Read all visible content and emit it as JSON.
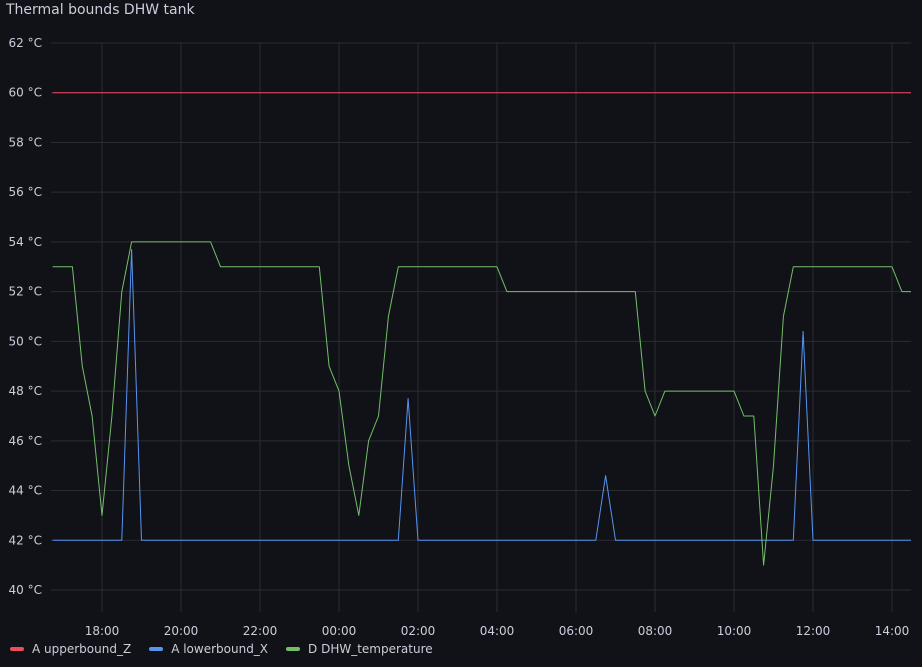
{
  "panel": {
    "title": "Thermal bounds DHW tank"
  },
  "chart_data": {
    "type": "line",
    "title": "Thermal bounds DHW tank",
    "y_unit": "°C",
    "ylim": [
      40,
      62
    ],
    "y_ticks": [
      "62 °C",
      "60 °C",
      "58 °C",
      "56 °C",
      "54 °C",
      "52 °C",
      "50 °C",
      "48 °C",
      "46 °C",
      "44 °C",
      "42 °C",
      "40 °C"
    ],
    "x_ticks": [
      "18:00",
      "20:00",
      "22:00",
      "00:00",
      "02:00",
      "04:00",
      "06:00",
      "08:00",
      "10:00",
      "12:00",
      "14:00"
    ],
    "grid": true,
    "legend_position": "bottom-left",
    "series": [
      {
        "name": "A upperbound_Z",
        "color": "#f2495c",
        "points": [
          [
            "16:45",
            60
          ],
          [
            "14:30",
            60
          ]
        ]
      },
      {
        "name": "A lowerbound_X",
        "color": "#5794f2",
        "points": [
          [
            "16:45",
            42
          ],
          [
            "18:30",
            42
          ],
          [
            "18:45",
            53.7
          ],
          [
            "19:00",
            42
          ],
          [
            "01:30",
            42
          ],
          [
            "01:45",
            47.7
          ],
          [
            "02:00",
            42
          ],
          [
            "06:30",
            42
          ],
          [
            "06:45",
            44.6
          ],
          [
            "07:00",
            42
          ],
          [
            "11:30",
            42
          ],
          [
            "11:45",
            50.4
          ],
          [
            "12:00",
            42
          ],
          [
            "14:30",
            42
          ]
        ]
      },
      {
        "name": "D DHW_temperature",
        "color": "#73bf69",
        "points": [
          [
            "16:45",
            53
          ],
          [
            "17:15",
            53
          ],
          [
            "17:30",
            49
          ],
          [
            "17:45",
            47
          ],
          [
            "18:00",
            43
          ],
          [
            "18:15",
            47
          ],
          [
            "18:30",
            52
          ],
          [
            "18:45",
            54
          ],
          [
            "20:45",
            54
          ],
          [
            "21:00",
            53
          ],
          [
            "23:30",
            53
          ],
          [
            "23:45",
            49
          ],
          [
            "00:00",
            48
          ],
          [
            "00:15",
            45
          ],
          [
            "00:30",
            43
          ],
          [
            "00:45",
            46
          ],
          [
            "01:00",
            47
          ],
          [
            "01:15",
            51
          ],
          [
            "01:30",
            53
          ],
          [
            "04:00",
            53
          ],
          [
            "04:15",
            52
          ],
          [
            "07:30",
            52
          ],
          [
            "07:45",
            48
          ],
          [
            "08:00",
            47
          ],
          [
            "08:15",
            48
          ],
          [
            "10:00",
            48
          ],
          [
            "10:15",
            47
          ],
          [
            "10:30",
            47
          ],
          [
            "10:45",
            41
          ],
          [
            "11:00",
            45
          ],
          [
            "11:15",
            51
          ],
          [
            "11:30",
            53
          ],
          [
            "14:00",
            53
          ],
          [
            "14:15",
            52
          ],
          [
            "14:30",
            52
          ]
        ]
      }
    ]
  }
}
